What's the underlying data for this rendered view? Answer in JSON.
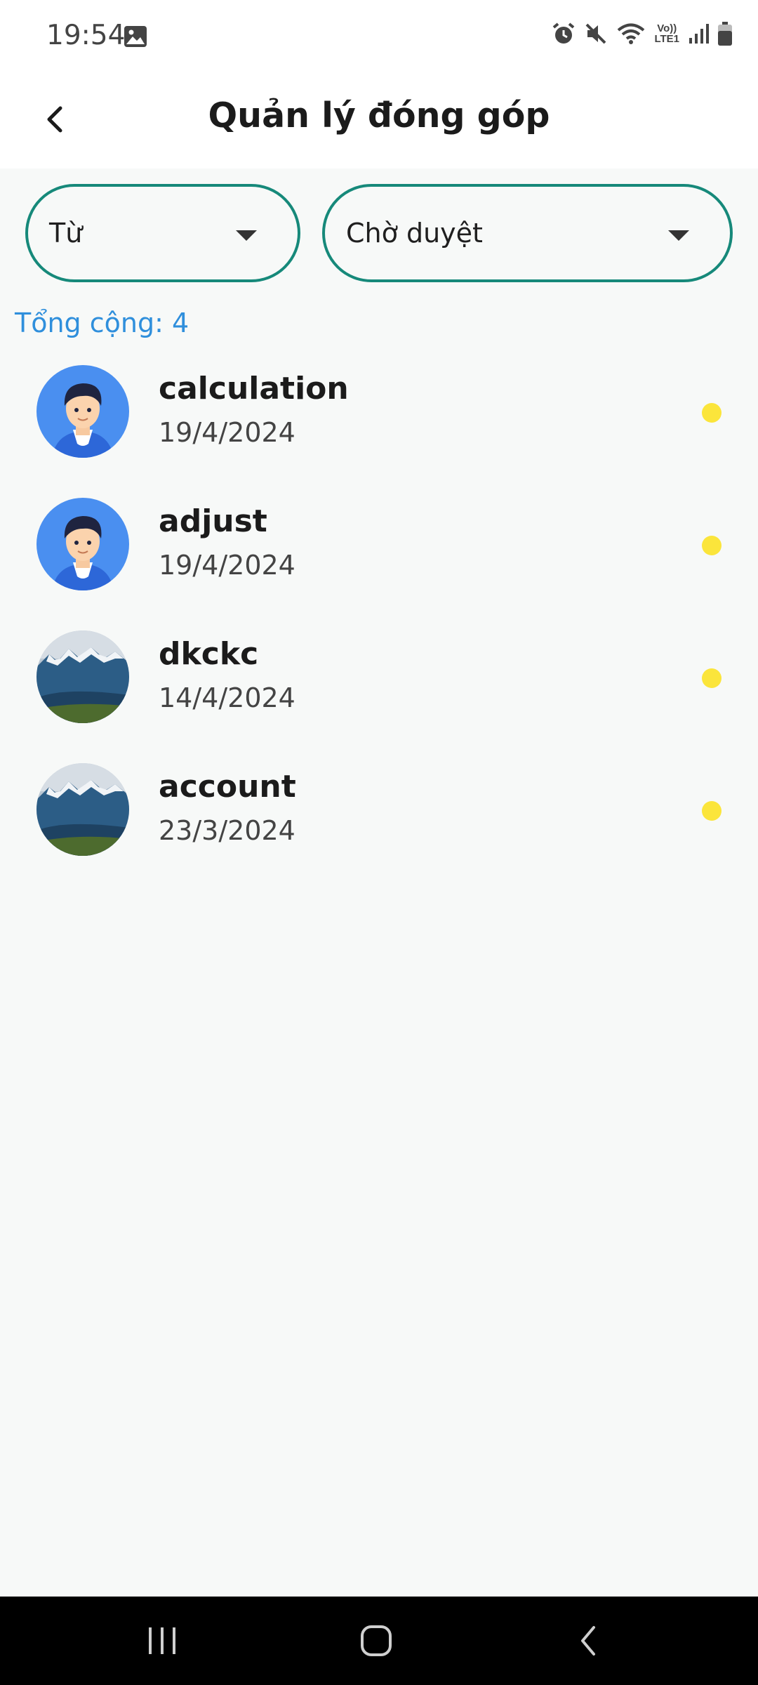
{
  "status_bar": {
    "time": "19:54",
    "icons": [
      "image-icon",
      "alarm-icon",
      "mute-icon",
      "wifi-icon",
      "volte-icon",
      "signal-icon",
      "battery-icon"
    ],
    "volte_top": "Vo))",
    "volte_bottom": "LTE1"
  },
  "header": {
    "title": "Quản lý đóng góp",
    "back_icon": "chevron-left-icon"
  },
  "filters": {
    "from_label": "Từ",
    "status_label": "Chờ duyệt",
    "caret_icon": "caret-down-icon"
  },
  "summary": {
    "total_text": "Tổng cộng: 4"
  },
  "items": [
    {
      "name": "calculation",
      "date": "19/4/2024",
      "avatar": "person-avatar",
      "status_color": "#fbe53b"
    },
    {
      "name": "adjust",
      "date": "19/4/2024",
      "avatar": "person-avatar",
      "status_color": "#fbe53b"
    },
    {
      "name": "dkckc",
      "date": "14/4/2024",
      "avatar": "mountain-photo-avatar",
      "status_color": "#fbe53b"
    },
    {
      "name": "account",
      "date": "23/3/2024",
      "avatar": "mountain-photo-avatar",
      "status_color": "#fbe53b"
    }
  ],
  "nav_bar": {
    "buttons": [
      "recents-icon",
      "home-icon",
      "back-icon"
    ]
  },
  "colors": {
    "accent_border": "#16897a",
    "total_text": "#2f8fdc",
    "pending_dot": "#fbe53b",
    "avatar_bg": "#4a8ff0"
  }
}
